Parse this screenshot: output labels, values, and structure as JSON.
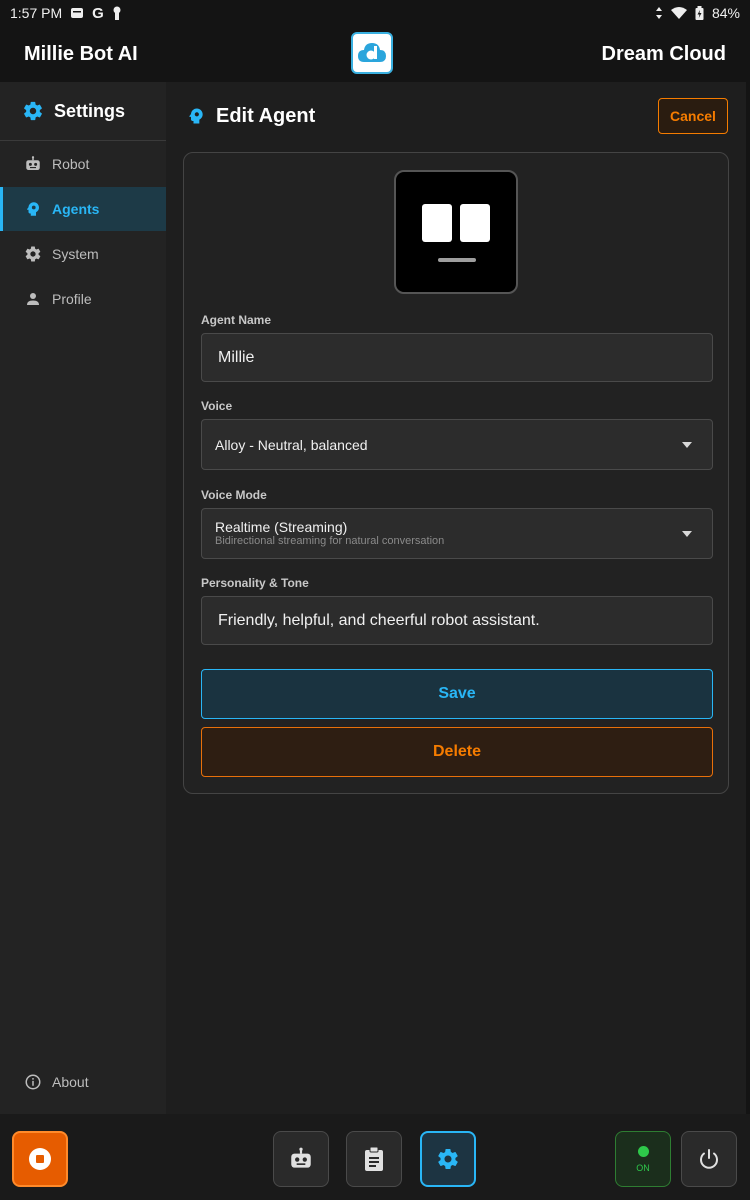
{
  "status_bar": {
    "time": "1:57 PM",
    "battery": "84%"
  },
  "app_bar": {
    "left_title": "Millie Bot AI",
    "right_title": "Dream Cloud"
  },
  "sidebar": {
    "title": "Settings",
    "items": [
      {
        "label": "Robot",
        "icon": "robot-icon",
        "active": false
      },
      {
        "label": "Agents",
        "icon": "agent-icon",
        "active": true
      },
      {
        "label": "System",
        "icon": "gear-icon",
        "active": false
      },
      {
        "label": "Profile",
        "icon": "person-icon",
        "active": false
      }
    ],
    "about_label": "About"
  },
  "main": {
    "title": "Edit Agent",
    "cancel_label": "Cancel",
    "form": {
      "agent_name_label": "Agent Name",
      "agent_name_value": "Millie",
      "voice_label": "Voice",
      "voice_value": "Alloy - Neutral, balanced",
      "voice_mode_label": "Voice Mode",
      "voice_mode_value": "Realtime (Streaming)",
      "voice_mode_description": "Bidirectional streaming for natural conversation",
      "personality_label": "Personality & Tone",
      "personality_value": "Friendly, helpful, and cheerful robot assistant."
    },
    "save_label": "Save",
    "delete_label": "Delete"
  },
  "bottom_bar": {
    "on_label": "ON"
  },
  "colors": {
    "accent": "#29b6f6",
    "warning": "#f57c00",
    "success": "#2ec84a"
  }
}
